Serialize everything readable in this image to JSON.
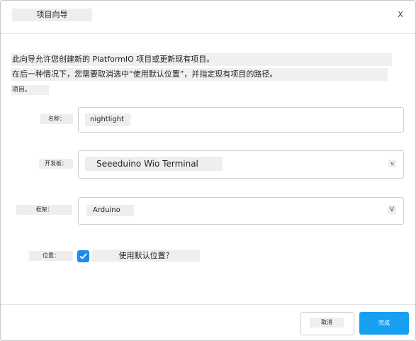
{
  "dialog": {
    "title": "项目向导",
    "close_label": "X"
  },
  "description": {
    "line1": "此向导允许您创建新的 PlatformIO 项目或更新现有项目。",
    "line2": "在后一种情况下，您需要取消选中“使用默认位置”，并指定现有项目的路径。",
    "line3": "项目。"
  },
  "form": {
    "name_label": "名称：",
    "name_value": "nightlight",
    "board_label": "开发板：",
    "board_value": "Seeeduino Wio Terminal",
    "board_dropdown_glyph": "v",
    "framework_label": "框架：",
    "framework_value": "Arduino",
    "framework_dropdown_glyph": "V",
    "location_label": "位置：",
    "default_location_checked": true,
    "default_location_label": "使用默认位置？"
  },
  "footer": {
    "cancel_label": "取消",
    "finish_label": "完成"
  },
  "colors": {
    "accent": "#17a0f2",
    "checkbox": "#1a8cf0"
  }
}
